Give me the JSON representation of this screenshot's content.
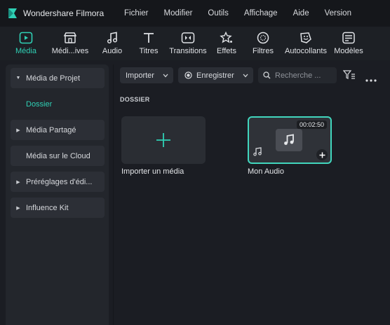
{
  "menubar": {
    "app_title": "Wondershare Filmora",
    "items": [
      "Fichier",
      "Modifier",
      "Outils",
      "Affichage",
      "Aide",
      "Version"
    ]
  },
  "toolbar": {
    "tabs": [
      {
        "label": "Média",
        "icon": "media-icon",
        "active": true
      },
      {
        "label": "Médi...ives",
        "icon": "store-icon",
        "active": false
      },
      {
        "label": "Audio",
        "icon": "music-note-icon",
        "active": false
      },
      {
        "label": "Titres",
        "icon": "title-t-icon",
        "active": false
      },
      {
        "label": "Transitions",
        "icon": "transition-icon",
        "active": false
      },
      {
        "label": "Effets",
        "icon": "effects-star-icon",
        "active": false
      },
      {
        "label": "Filtres",
        "icon": "filter-icon",
        "active": false
      },
      {
        "label": "Autocollants",
        "icon": "sticker-icon",
        "active": false
      },
      {
        "label": "Modèles",
        "icon": "template-icon",
        "active": false
      }
    ]
  },
  "sidebar": {
    "items": [
      {
        "label": "Média de Projet",
        "expanded": true
      },
      {
        "label": "Dossier",
        "active": true
      },
      {
        "label": "Média Partagé"
      },
      {
        "label": "Média sur le Cloud"
      },
      {
        "label": "Préréglages d'édi..."
      },
      {
        "label": "Influence Kit"
      }
    ]
  },
  "content": {
    "import_label": "Importer",
    "record_label": "Enregistrer",
    "search_placeholder": "Recherche ...",
    "section_label": "DOSSIER",
    "cards": [
      {
        "caption": "Importer un média"
      },
      {
        "caption": "Mon Audio",
        "duration": "00:02:50",
        "selected": true
      }
    ]
  },
  "colors": {
    "accent": "#2fd0b5",
    "background": "#1b1d23",
    "panel": "#23262c"
  }
}
